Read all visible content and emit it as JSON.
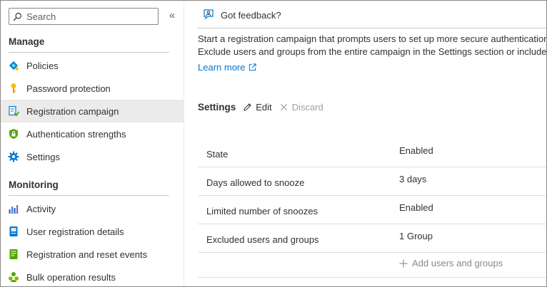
{
  "sidebar": {
    "search_placeholder": "Search",
    "collapse_label": "«",
    "sections": [
      {
        "title": "Manage",
        "items": [
          {
            "label": "Policies",
            "icon": "policies-icon"
          },
          {
            "label": "Password protection",
            "icon": "key-icon"
          },
          {
            "label": "Registration campaign",
            "icon": "registration-icon",
            "active": true
          },
          {
            "label": "Authentication strengths",
            "icon": "shield-icon"
          },
          {
            "label": "Settings",
            "icon": "gear-icon"
          }
        ]
      },
      {
        "title": "Monitoring",
        "items": [
          {
            "label": "Activity",
            "icon": "activity-chart-icon"
          },
          {
            "label": "User registration details",
            "icon": "document-icon"
          },
          {
            "label": "Registration and reset events",
            "icon": "events-icon"
          },
          {
            "label": "Bulk operation results",
            "icon": "people-icon"
          }
        ]
      }
    ]
  },
  "main": {
    "feedback_label": "Got feedback?",
    "description_line1": "Start a registration campaign that prompts users to set up more secure authentication",
    "description_line2": "Exclude users and groups from the entire campaign in the Settings section or include",
    "learn_more": "Learn more",
    "settings": {
      "title": "Settings",
      "edit_label": "Edit",
      "discard_label": "Discard"
    },
    "rows": [
      {
        "key": "State",
        "value": "Enabled"
      },
      {
        "key": "Days allowed to snooze",
        "value": "3 days"
      },
      {
        "key": "Limited number of snoozes",
        "value": "Enabled"
      },
      {
        "key": "Excluded users and groups",
        "value": "1 Group"
      }
    ],
    "add_label": "Add users and groups"
  },
  "colors": {
    "accent": "#0078d4",
    "active_bg": "#edebe9",
    "text": "#323130",
    "disabled": "#a19f9d"
  }
}
